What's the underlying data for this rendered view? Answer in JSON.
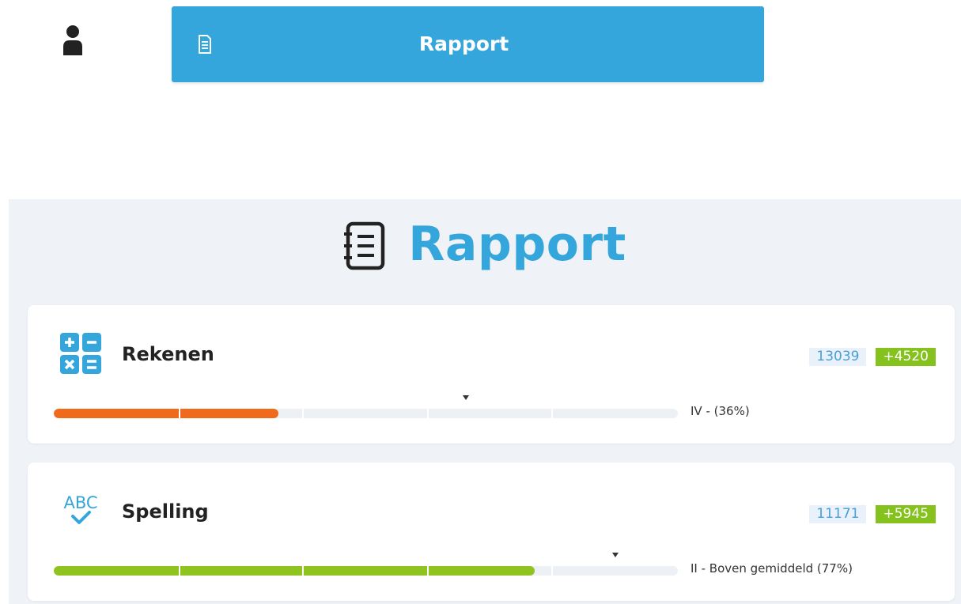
{
  "top_button": {
    "label": "Rapport",
    "color": "#35a6dc"
  },
  "panel": {
    "title": "Rapport",
    "background": "#eff3f7"
  },
  "subjects": [
    {
      "name": "Rekenen",
      "icon": "calculator-icon",
      "score": "13039",
      "gain": "+4520",
      "progress_fraction": 0.36,
      "marker_fraction": 0.66,
      "level_text": "IV - (36%)",
      "bar_color": "#f06a1e"
    },
    {
      "name": "Spelling",
      "icon": "abc-check-icon",
      "score": "11171",
      "gain": "+5945",
      "progress_fraction": 0.77,
      "marker_fraction": 0.9,
      "level_text": "II - Boven gemiddeld (77%)",
      "bar_color": "#8fc31f"
    }
  ],
  "colors": {
    "accent": "#35a6dc",
    "gain_badge": "#86c21d",
    "score_badge_bg": "#e9f1fa"
  }
}
